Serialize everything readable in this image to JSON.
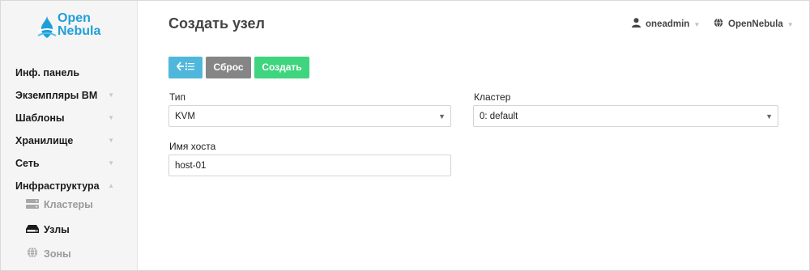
{
  "colors": {
    "brand": "#1f9fd8",
    "back_button": "#4fb7dc",
    "reset_button": "#858585",
    "create_button": "#3fd47e",
    "sidebar_bg": "#f5f5f5"
  },
  "logo": {
    "line1": "Open",
    "line2": "Nebula"
  },
  "sidebar": {
    "items": [
      {
        "label": "Инф. панель",
        "has_chevron": false
      },
      {
        "label": "Экземпляры ВМ",
        "has_chevron": true,
        "chevron": "down"
      },
      {
        "label": "Шаблоны",
        "has_chevron": true,
        "chevron": "down"
      },
      {
        "label": "Хранилище",
        "has_chevron": true,
        "chevron": "down"
      },
      {
        "label": "Сеть",
        "has_chevron": true,
        "chevron": "down"
      },
      {
        "label": "Инфраструктура",
        "has_chevron": true,
        "chevron": "up"
      }
    ],
    "subitems": [
      {
        "label": "Кластеры",
        "icon": "server-rack-icon",
        "active": false
      },
      {
        "label": "Узлы",
        "icon": "hdd-icon",
        "active": true
      },
      {
        "label": "Зоны",
        "icon": "globe-icon",
        "active": false
      }
    ]
  },
  "header": {
    "title": "Создать узел",
    "user": "oneadmin",
    "zone": "OpenNebula"
  },
  "toolbar": {
    "back_icon": "back-list-icon",
    "reset_label": "Сброс",
    "create_label": "Создать"
  },
  "form": {
    "type_label": "Тип",
    "type_value": "KVM",
    "cluster_label": "Кластер",
    "cluster_value": "0: default",
    "hostname_label": "Имя хоста",
    "hostname_value": "host-01"
  }
}
